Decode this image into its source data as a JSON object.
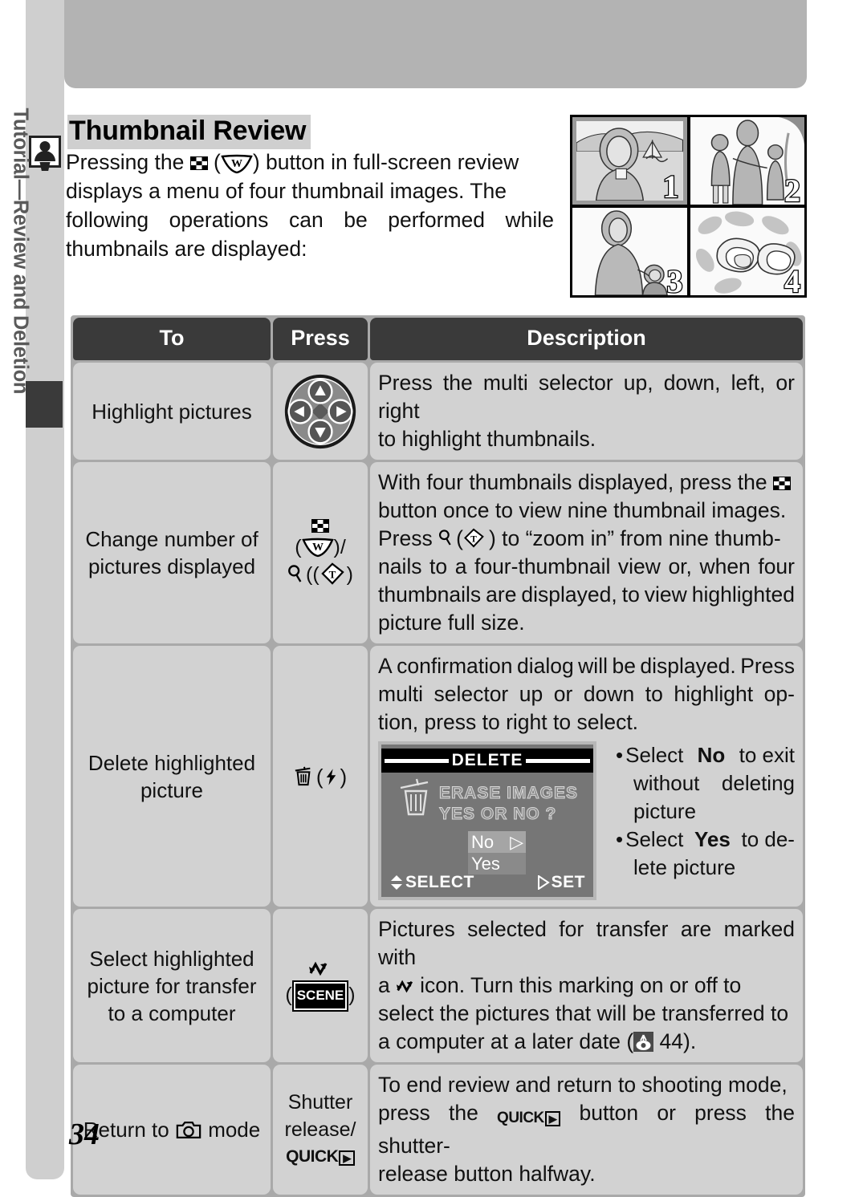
{
  "sidebar": {
    "tab_text": "Tutorial—Review and Deletion",
    "icon": "review-delete-icon"
  },
  "page": {
    "number": "34",
    "heading": "Thumbnail Review"
  },
  "intro": {
    "line1_a": "Pressing the",
    "line1_b": ") button in full-screen review",
    "line2": "displays a menu of four thumbnail images.  The",
    "line3_words": [
      "following",
      "operations",
      "can",
      "be",
      "performed",
      "while"
    ],
    "line4": "thumbnails are displayed:"
  },
  "figure": {
    "thumbnails": [
      {
        "number": "1",
        "selected": true,
        "scene": "woman-at-lake-with-sailboat"
      },
      {
        "number": "2",
        "selected": false,
        "scene": "mother-with-two-children"
      },
      {
        "number": "3",
        "selected": false,
        "scene": "woman-with-child"
      },
      {
        "number": "4",
        "selected": false,
        "scene": "flowers"
      }
    ],
    "transfer_mark": "transfer-mark-icon"
  },
  "table": {
    "headers": [
      "To",
      "Press",
      "Description"
    ],
    "rows": [
      {
        "to": "Highlight pictures",
        "press_icon": "multi-selector-pad",
        "desc_lines": [
          "Press the multi selector up, down, left, or right",
          "to highlight thumbnails."
        ]
      },
      {
        "to_line1": "Change number of",
        "to_line2": "pictures displayed",
        "press_icons": [
          "thumbnail-button-icon",
          "zoom-wide-w-icon",
          "magnifier-icon",
          "zoom-tele-t-icon"
        ],
        "desc_l1_a": "With four thumbnails displayed, press the",
        "desc_l2": "button once to view nine thumbnail images.",
        "desc_l3_a": "Press",
        "desc_l3_b": ") to “zoom in” from nine thumb-",
        "desc_l4_words": [
          "nails",
          "to",
          "a",
          "four-thumbnail",
          "view",
          "or,",
          "when",
          "four"
        ],
        "desc_l5_words": [
          "thumbnails",
          "are",
          "displayed,",
          "to",
          "view",
          "highlighted"
        ],
        "desc_l6": "picture full size."
      },
      {
        "to_line1": "Delete highlighted",
        "to_line2": "picture",
        "press_icons": [
          "trash-icon",
          "flash-button-icon"
        ],
        "desc_l1_words": [
          "A",
          "confirmation",
          "dialog",
          "will",
          "be",
          "displayed.",
          "Press"
        ],
        "desc_l2_words": [
          "multi",
          "selector",
          "up",
          "or",
          "down",
          "to",
          "highlight",
          "op-"
        ],
        "desc_l3": "tion, press to right to select.",
        "lcd": {
          "title": "DELETE",
          "message_line1": "ERASE IMAGES",
          "message_line2": "YES OR NO  ?",
          "options": [
            {
              "label": "No",
              "current": true,
              "arrow": "▷"
            },
            {
              "label": "Yes",
              "current": false,
              "arrow": ""
            }
          ],
          "footer_left": "SELECT",
          "footer_right": "SET",
          "footer_left_icon": "up-down-arrows-icon",
          "footer_right_icon": "right-arrow-icon"
        },
        "bullets": [
          {
            "prefix": "Select",
            "strong": "No",
            "suffix": "to exit",
            "cont": [
              "without",
              "deleting"
            ],
            "cont2": "picture"
          },
          {
            "prefix": "Select",
            "strong": "Yes",
            "suffix": "to de-",
            "cont2": "lete picture"
          }
        ]
      },
      {
        "to_line1": "Select highlighted",
        "to_line2": "picture for transfer",
        "to_line3": "to a computer",
        "press_icons": [
          "transfer-mark-icon",
          "scene-button-icon"
        ],
        "scene_label": "SCENE",
        "desc_l1": "Pictures selected for transfer are marked with",
        "desc_l2_a": "a",
        "desc_l2_b": "icon.  Turn this marking on or off to",
        "desc_l3": "select the pictures that will be transferred to",
        "desc_l4_a": "a computer at a later date (",
        "desc_l4_b": "44)."
      },
      {
        "to_line1": "Return to",
        "to_line2": "mode",
        "to_icon": "camera-icon",
        "press_line1": "Shutter",
        "press_line2": "release/",
        "press_line3": "QUICK",
        "press_icon": "quick-review-button-icon",
        "desc_l1": "To end review and return to shooting mode,",
        "desc_l2_a": "press the",
        "desc_l2_b": "button or press the shutter-",
        "desc_l3": "release button halfway."
      }
    ]
  },
  "colors": {
    "header_bg": "#3a3a3a",
    "cell_bg": "#d2d2d2",
    "table_bg": "#a9a9a9",
    "side_tab": "#cfcfcf",
    "band": "#b3b3b3",
    "lcd_bg": "#767676"
  }
}
